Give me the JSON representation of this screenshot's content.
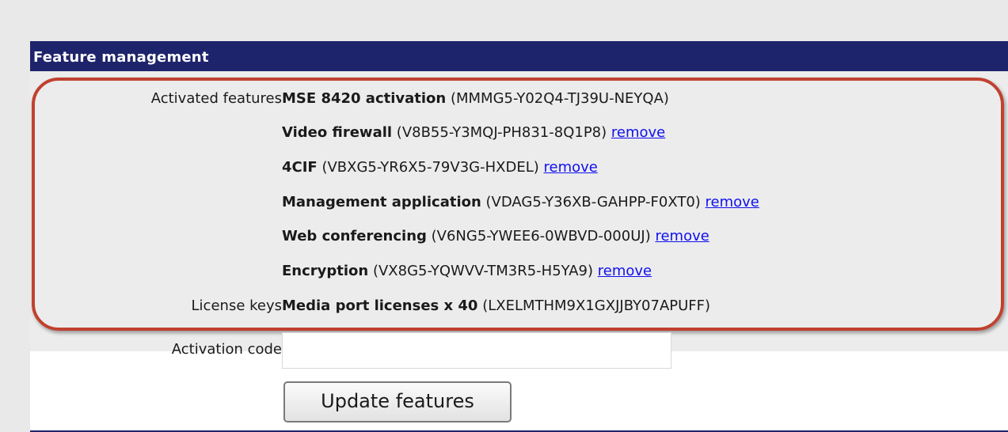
{
  "section": {
    "title": "Feature management"
  },
  "activated_features_label": "Activated features",
  "features": [
    {
      "name": "MSE 8420 activation",
      "key": "(MMMG5-Y02Q4-TJ39U-NEYQA)",
      "remove": ""
    },
    {
      "name": "Video firewall",
      "key": "(V8B55-Y3MQJ-PH831-8Q1P8)",
      "remove": "remove"
    },
    {
      "name": "4CIF",
      "key": "(VBXG5-YR6X5-79V3G-HXDEL)",
      "remove": "remove"
    },
    {
      "name": "Management application",
      "key": "(VDAG5-Y36XB-GAHPP-F0XT0)",
      "remove": "remove"
    },
    {
      "name": "Web conferencing",
      "key": "(V6NG5-YWEE6-0WBVD-000UJ)",
      "remove": "remove"
    },
    {
      "name": "Encryption",
      "key": "(VX8G5-YQWVV-TM3R5-H5YA9)",
      "remove": "remove"
    }
  ],
  "license_keys_label": "License keys",
  "license": {
    "name": "Media port licenses x 40",
    "key": "(LXELMTHM9X1GXJJBY07APUFF)"
  },
  "activation_code_label": "Activation code",
  "activation_code_value": "",
  "update_button_label": "Update features",
  "colors": {
    "header_bg": "#1e246b",
    "link": "#1010ee",
    "highlight_outline": "#c0412f"
  }
}
